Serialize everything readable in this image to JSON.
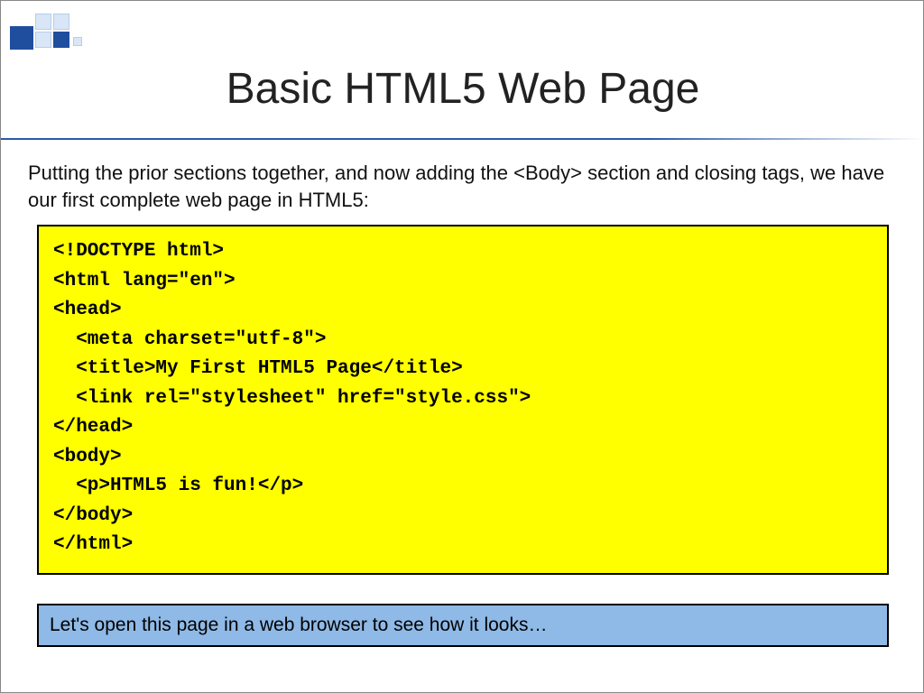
{
  "title": "Basic HTML5 Web Page",
  "intro": "Putting the prior sections together, and now adding the <Body> section and closing tags, we have our first complete web page in HTML5:",
  "code": "<!DOCTYPE html>\n<html lang=\"en\">\n<head>\n  <meta charset=\"utf-8\">\n  <title>My First HTML5 Page</title>\n  <link rel=\"stylesheet\" href=\"style.css\">\n</head>\n<body>\n  <p>HTML5 is fun!</p>\n</body>\n</html>",
  "callout": "Let's open this page in a web browser to see how it looks…"
}
